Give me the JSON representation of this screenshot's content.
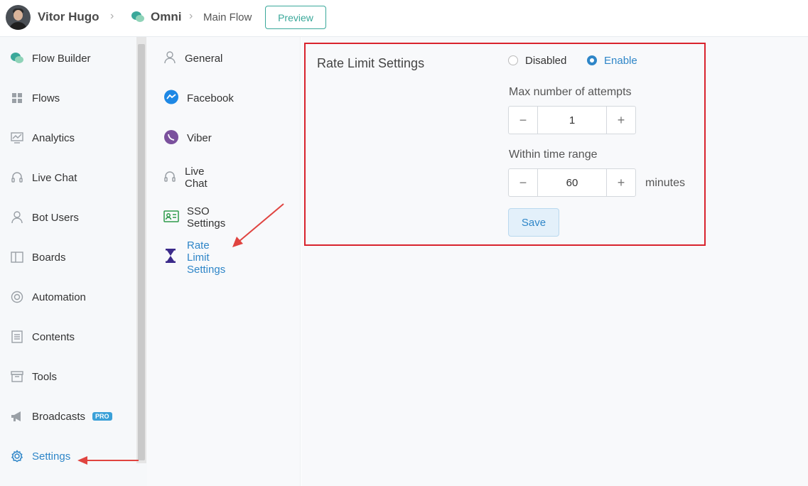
{
  "header": {
    "user_name": "Vitor Hugo",
    "bot_name": "Omni",
    "flow_name": "Main Flow",
    "preview_label": "Preview"
  },
  "sidebar": {
    "items": [
      {
        "label": "Flow Builder",
        "icon": "flow-builder-icon"
      },
      {
        "label": "Flows",
        "icon": "grid-icon"
      },
      {
        "label": "Analytics",
        "icon": "analytics-icon"
      },
      {
        "label": "Live Chat",
        "icon": "headset-icon"
      },
      {
        "label": "Bot Users",
        "icon": "user-icon"
      },
      {
        "label": "Boards",
        "icon": "board-icon"
      },
      {
        "label": "Automation",
        "icon": "automation-icon"
      },
      {
        "label": "Contents",
        "icon": "contents-icon"
      },
      {
        "label": "Tools",
        "icon": "tools-icon"
      },
      {
        "label": "Broadcasts",
        "icon": "megaphone-icon",
        "badge": "PRO"
      },
      {
        "label": "Settings",
        "icon": "gear-icon",
        "active": true
      }
    ]
  },
  "submenu": {
    "items": [
      {
        "label": "General",
        "icon": "user-icon"
      },
      {
        "label": "Facebook",
        "icon": "messenger-icon"
      },
      {
        "label": "Viber",
        "icon": "viber-icon"
      },
      {
        "label": "Live Chat",
        "icon": "headset-icon"
      },
      {
        "label": "SSO Settings",
        "icon": "id-card-icon"
      },
      {
        "label": "Rate Limit Settings",
        "icon": "hourglass-icon",
        "active": true
      }
    ]
  },
  "rate_limit": {
    "title": "Rate Limit Settings",
    "options": {
      "disabled": "Disabled",
      "enable": "Enable",
      "selected": "Enable"
    },
    "max_attempts_label": "Max number of attempts",
    "max_attempts_value": "1",
    "time_range_label": "Within time range",
    "time_range_value": "60",
    "time_unit": "minutes",
    "save_label": "Save",
    "minus": "−",
    "plus": "+"
  },
  "colors": {
    "accent": "#2f86c8",
    "preview": "#3aa89a",
    "highlight": "#d9232d"
  }
}
